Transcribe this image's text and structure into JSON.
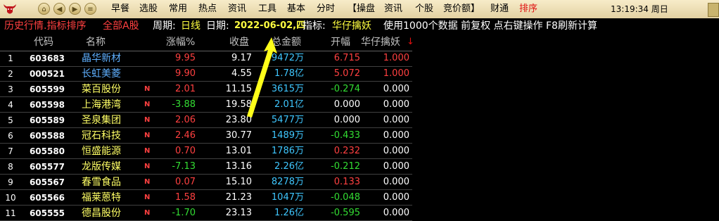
{
  "menu": [
    {
      "label": "早餐",
      "color": "black"
    },
    {
      "label": "选股",
      "color": "black"
    },
    {
      "label": "常用",
      "color": "black"
    },
    {
      "label": "热点",
      "color": "black"
    },
    {
      "label": "资讯",
      "color": "black"
    },
    {
      "label": "工具",
      "color": "black"
    },
    {
      "label": "基本",
      "color": "black"
    },
    {
      "label": "分时",
      "color": "black"
    },
    {
      "label": "【操盘",
      "color": "black"
    },
    {
      "label": "资讯",
      "color": "black"
    },
    {
      "label": "个股",
      "color": "black"
    },
    {
      "label": "竞价额】",
      "color": "black"
    },
    {
      "label": "财通",
      "color": "black"
    },
    {
      "label": "排序",
      "color": "red"
    }
  ],
  "clock": "13:19:34 周日",
  "info": {
    "title": "历史行情.指标排序",
    "market": "全部A股",
    "period_label": "周期:",
    "period_value": "日线",
    "date_label": "日期:",
    "date_value": "2022-06-02,四",
    "indicator_label": "指标:",
    "indicator_value": "华仔擒妖",
    "note": "使用1000个数据 前复权 点右键操作 F8刷新计算"
  },
  "header": {
    "code": "代码",
    "name": "名称",
    "change": "涨幅%",
    "close": "收盘",
    "amount": "总金额",
    "open": "开幅",
    "indicator": "华仔擒妖",
    "sort_arrow": "↓"
  },
  "rows": [
    {
      "idx": "1",
      "code": "603683",
      "name": "晶华新材",
      "flag": "",
      "chg": "9.95",
      "chg_color": "red",
      "close": "9.17",
      "amt": "9472万",
      "open": "6.715",
      "open_color": "red",
      "ind": "1.000",
      "ind_color": "red"
    },
    {
      "idx": "2",
      "code": "000521",
      "name": "长虹美菱",
      "flag": "",
      "chg": "9.90",
      "chg_color": "red",
      "close": "4.55",
      "amt": "1.78亿",
      "open": "5.072",
      "open_color": "red",
      "ind": "1.000",
      "ind_color": "red"
    },
    {
      "idx": "3",
      "code": "605599",
      "name": "菜百股份",
      "flag": "N",
      "chg": "2.01",
      "chg_color": "red",
      "close": "11.15",
      "amt": "3615万",
      "open": "-0.274",
      "open_color": "green",
      "ind": "0.000",
      "ind_color": "white"
    },
    {
      "idx": "4",
      "code": "605598",
      "name": "上海港湾",
      "flag": "N",
      "chg": "-3.88",
      "chg_color": "green",
      "close": "19.58",
      "amt": "2.01亿",
      "open": "0.000",
      "open_color": "white",
      "ind": "0.000",
      "ind_color": "white"
    },
    {
      "idx": "5",
      "code": "605589",
      "name": "圣泉集团",
      "flag": "N",
      "chg": "2.06",
      "chg_color": "red",
      "close": "23.80",
      "amt": "5477万",
      "open": "0.000",
      "open_color": "white",
      "ind": "0.000",
      "ind_color": "white"
    },
    {
      "idx": "6",
      "code": "605588",
      "name": "冠石科技",
      "flag": "N",
      "chg": "2.46",
      "chg_color": "red",
      "close": "30.77",
      "amt": "1489万",
      "open": "-0.433",
      "open_color": "green",
      "ind": "0.000",
      "ind_color": "white"
    },
    {
      "idx": "7",
      "code": "605580",
      "name": "恒盛能源",
      "flag": "N",
      "chg": "0.70",
      "chg_color": "red",
      "close": "13.01",
      "amt": "1786万",
      "open": "0.232",
      "open_color": "red",
      "ind": "0.000",
      "ind_color": "white"
    },
    {
      "idx": "8",
      "code": "605577",
      "name": "龙版传媒",
      "flag": "N",
      "chg": "-7.13",
      "chg_color": "green",
      "close": "13.16",
      "amt": "2.26亿",
      "open": "-0.212",
      "open_color": "green",
      "ind": "0.000",
      "ind_color": "white"
    },
    {
      "idx": "9",
      "code": "605567",
      "name": "春雪食品",
      "flag": "N",
      "chg": "0.07",
      "chg_color": "red",
      "close": "15.10",
      "amt": "8278万",
      "open": "0.133",
      "open_color": "red",
      "ind": "0.000",
      "ind_color": "white"
    },
    {
      "idx": "10",
      "code": "605566",
      "name": "福莱蒽特",
      "flag": "N",
      "chg": "1.58",
      "chg_color": "red",
      "close": "21.23",
      "amt": "1047万",
      "open": "-0.048",
      "open_color": "green",
      "ind": "0.000",
      "ind_color": "white"
    },
    {
      "idx": "11",
      "code": "605555",
      "name": "德昌股份",
      "flag": "N",
      "chg": "-1.70",
      "chg_color": "green",
      "close": "23.13",
      "amt": "1.26亿",
      "open": "-0.595",
      "open_color": "green",
      "ind": "0.000",
      "ind_color": "white"
    }
  ]
}
